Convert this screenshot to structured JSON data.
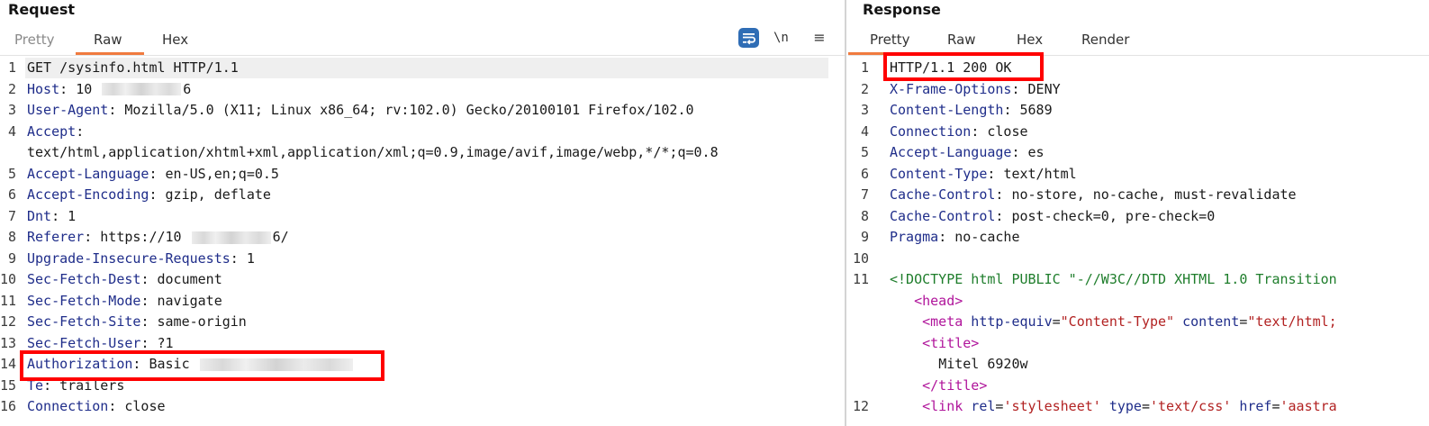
{
  "request": {
    "title": "Request",
    "tabs": [
      "Pretty",
      "Raw",
      "Hex"
    ],
    "active_tab": "Raw",
    "toolbar": {
      "wrap_icon": "text-wrap-icon",
      "newline_label": "\\n",
      "menu_icon": "menu-icon"
    },
    "lines": [
      {
        "n": "1",
        "t": "GET /sysinfo.html HTTP/1.1"
      },
      {
        "n": "2",
        "k": "Host",
        "v": "10 ",
        "redacted": true,
        "v2": "6"
      },
      {
        "n": "3",
        "k": "User-Agent",
        "v": "Mozilla/5.0 (X11; Linux x86_64; rv:102.0) Gecko/20100101 Firefox/102.0"
      },
      {
        "n": "4",
        "k": "Accept",
        "v": ""
      },
      {
        "n": "",
        "t": "text/html,application/xhtml+xml,application/xml;q=0.9,image/avif,image/webp,*/*;q=0.8"
      },
      {
        "n": "5",
        "k": "Accept-Language",
        "v": "en-US,en;q=0.5"
      },
      {
        "n": "6",
        "k": "Accept-Encoding",
        "v": "gzip, deflate"
      },
      {
        "n": "7",
        "k": "Dnt",
        "v": "1"
      },
      {
        "n": "8",
        "k": "Referer",
        "v": "https://10 ",
        "redacted": true,
        "v2": "6/"
      },
      {
        "n": "9",
        "k": "Upgrade-Insecure-Requests",
        "v": "1"
      },
      {
        "n": "10",
        "k": "Sec-Fetch-Dest",
        "v": "document"
      },
      {
        "n": "11",
        "k": "Sec-Fetch-Mode",
        "v": "navigate"
      },
      {
        "n": "12",
        "k": "Sec-Fetch-Site",
        "v": "same-origin"
      },
      {
        "n": "13",
        "k": "Sec-Fetch-User",
        "v": "?1"
      },
      {
        "n": "14",
        "k": "Authorization",
        "v": "Basic ",
        "redacted": true,
        "v2": ""
      },
      {
        "n": "15",
        "k": "Te",
        "v": "trailers"
      },
      {
        "n": "16",
        "k": "Connection",
        "v": "close"
      }
    ]
  },
  "response": {
    "title": "Response",
    "tabs": [
      "Pretty",
      "Raw",
      "Hex",
      "Render"
    ],
    "active_tab": "Pretty",
    "lines": [
      {
        "n": "1",
        "t": "HTTP/1.1 200 OK"
      },
      {
        "n": "2",
        "k": "X-Frame-Options",
        "v": "DENY"
      },
      {
        "n": "3",
        "k": "Content-Length",
        "v": "5689"
      },
      {
        "n": "4",
        "k": "Connection",
        "v": "close"
      },
      {
        "n": "5",
        "k": "Accept-Language",
        "v": "es"
      },
      {
        "n": "6",
        "k": "Content-Type",
        "v": "text/html"
      },
      {
        "n": "7",
        "k": "Cache-Control",
        "v": "no-store, no-cache, must-revalidate"
      },
      {
        "n": "8",
        "k": "Cache-Control",
        "v": "post-check=0, pre-check=0"
      },
      {
        "n": "9",
        "k": "Pragma",
        "v": "no-cache"
      },
      {
        "n": "10",
        "t": ""
      },
      {
        "n": "11",
        "doctype": "<!DOCTYPE html PUBLIC \"-//W3C//DTD XHTML 1.0 Transition"
      },
      {
        "n": "",
        "html": [
          {
            "tag": "<head>"
          }
        ],
        "indent": "   "
      },
      {
        "n": "",
        "html": [
          {
            "tag": "<meta"
          },
          {
            "att": " http-equiv"
          },
          {
            "plain": "="
          },
          {
            "str": "\"Content-Type\""
          },
          {
            "att": " content"
          },
          {
            "plain": "="
          },
          {
            "str": "\"text/html;"
          }
        ],
        "indent": "    "
      },
      {
        "n": "",
        "html": [
          {
            "tag": "<title>"
          }
        ],
        "indent": "    "
      },
      {
        "n": "",
        "plain": "Mitel 6920w",
        "indent": "      "
      },
      {
        "n": "",
        "html": [
          {
            "tag": "</title>"
          }
        ],
        "indent": "    "
      },
      {
        "n": "12",
        "html": [
          {
            "tag": "<link"
          },
          {
            "att": " rel"
          },
          {
            "plain": "="
          },
          {
            "str": "'stylesheet'"
          },
          {
            "att": " type"
          },
          {
            "plain": "="
          },
          {
            "str": "'text/css'"
          },
          {
            "att": " href"
          },
          {
            "plain": "="
          },
          {
            "str": "'aastra"
          }
        ],
        "indent": "    "
      }
    ]
  }
}
